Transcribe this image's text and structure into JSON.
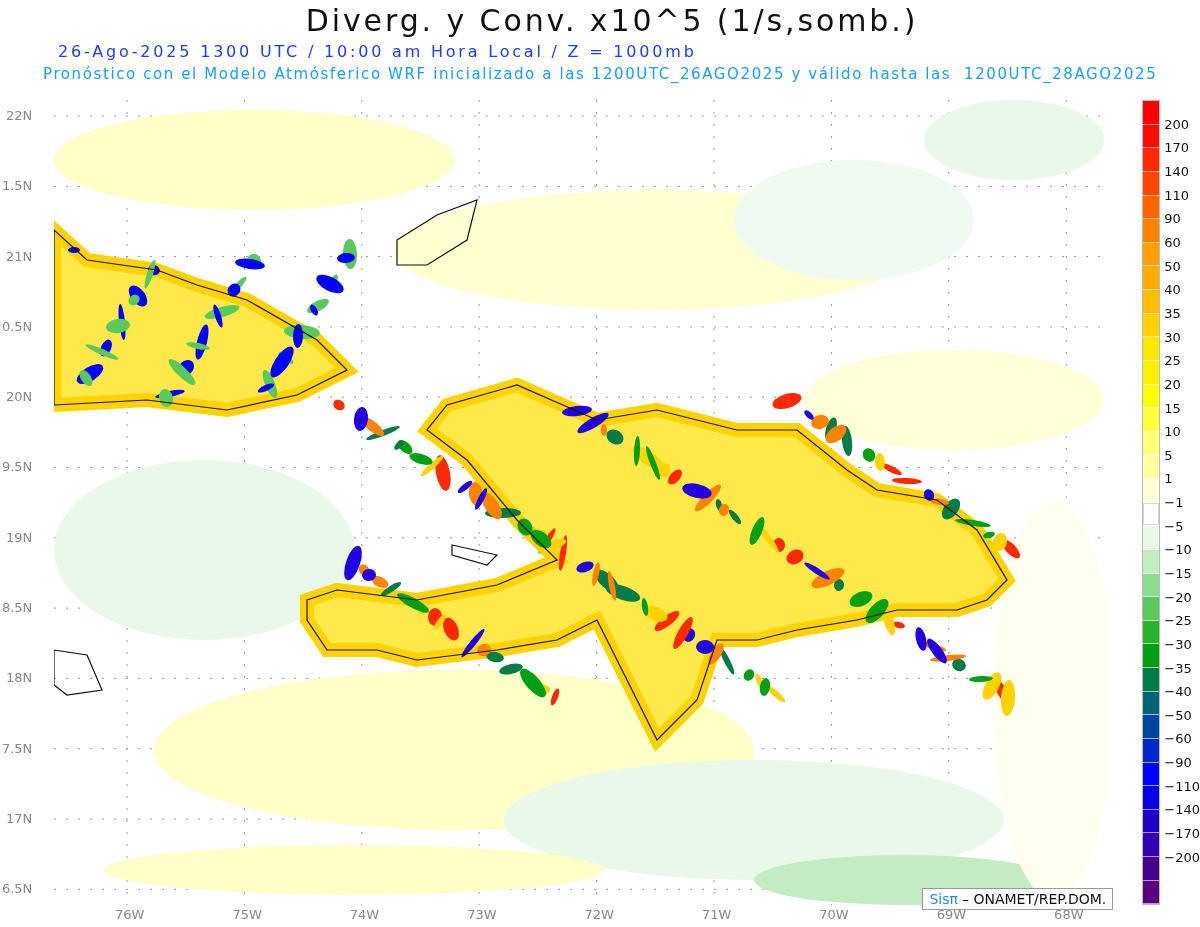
{
  "title": "Diverg. y Conv. x10^5 (1/s,somb.)",
  "subtitle": "26-Ago-2025 1300 UTC / 10:00 am Hora Local / Z = 1000mb",
  "forecast_note": "Pronóstico con el Modelo Atmósferico WRF inicializado a las 1200UTC_26AGO2025 y válido hasta las  1200UTC_28AGO2025",
  "y_axis": {
    "labels": [
      "22N",
      "1.5N",
      "21N",
      "0.5N",
      "20N",
      "9.5N",
      "19N",
      "8.5N",
      "18N",
      "7.5N",
      "17N",
      "6.5N"
    ]
  },
  "x_axis": {
    "labels": [
      "76W",
      "75W",
      "74W",
      "73W",
      "72W",
      "71W",
      "70W",
      "69W",
      "68W"
    ]
  },
  "colorbar": {
    "segments": [
      {
        "color": "#ff0000"
      },
      {
        "color": "#ff0a00"
      },
      {
        "color": "#ff2800"
      },
      {
        "color": "#ff4600"
      },
      {
        "color": "#ff6400"
      },
      {
        "color": "#ff8200"
      },
      {
        "color": "#ffa000"
      },
      {
        "color": "#ffaa00"
      },
      {
        "color": "#ffbe00"
      },
      {
        "color": "#ffd200"
      },
      {
        "color": "#ffe600"
      },
      {
        "color": "#fff000"
      },
      {
        "color": "#ffff00"
      },
      {
        "color": "#ffff3c"
      },
      {
        "color": "#ffff78"
      },
      {
        "color": "#ffffa0"
      },
      {
        "color": "#ffffd8"
      },
      {
        "color": "#ffffff"
      },
      {
        "color": "#eaf8ea"
      },
      {
        "color": "#c3ecc3"
      },
      {
        "color": "#8edc8e"
      },
      {
        "color": "#5ac85a"
      },
      {
        "color": "#28b428"
      },
      {
        "color": "#00a014"
      },
      {
        "color": "#007c46"
      },
      {
        "color": "#006478"
      },
      {
        "color": "#0046a0"
      },
      {
        "color": "#0028c8"
      },
      {
        "color": "#0000ff"
      },
      {
        "color": "#0a00e6"
      },
      {
        "color": "#1e00c8"
      },
      {
        "color": "#3200b4"
      },
      {
        "color": "#46008c"
      },
      {
        "color": "#5a0080"
      }
    ],
    "labels": [
      "200",
      "170",
      "140",
      "110",
      "90",
      "60",
      "50",
      "40",
      "35",
      "30",
      "25",
      "20",
      "15",
      "10",
      "5",
      "1",
      "−1",
      "−5",
      "−10",
      "−15",
      "−20",
      "−25",
      "−30",
      "−35",
      "−40",
      "−50",
      "−60",
      "−90",
      "−110",
      "−140",
      "−170",
      "−200"
    ]
  },
  "credit": {
    "logo": "Sisπ",
    "text": "– ONAMET/REP.DOM."
  }
}
